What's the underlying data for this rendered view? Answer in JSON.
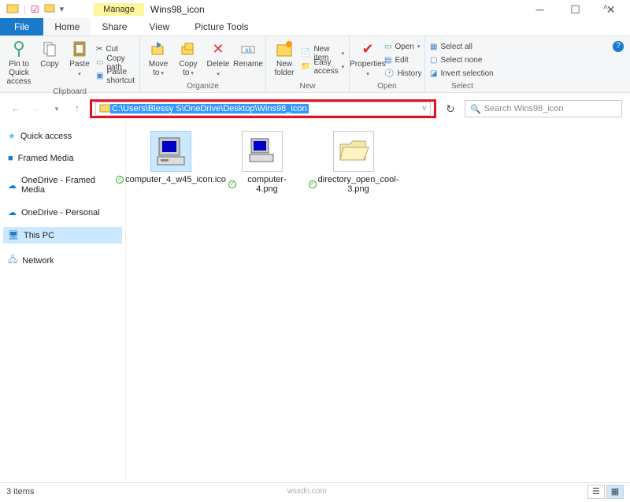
{
  "titlebar": {
    "manage": "Manage",
    "title": "Wins98_icon"
  },
  "file_tab": "File",
  "tabs": {
    "home": "Home",
    "share": "Share",
    "view": "View",
    "picture": "Picture Tools"
  },
  "ribbon": {
    "clipboard": {
      "pin": "Pin to Quick\naccess",
      "copy": "Copy",
      "paste": "Paste",
      "cut": "Cut",
      "copypath": "Copy path",
      "pasteshort": "Paste shortcut",
      "label": "Clipboard"
    },
    "organize": {
      "moveto": "Move\nto",
      "copyto": "Copy\nto",
      "delete": "Delete",
      "rename": "Rename",
      "label": "Organize"
    },
    "new": {
      "newfolder": "New\nfolder",
      "newitem": "New item",
      "easyaccess": "Easy access",
      "label": "New"
    },
    "open": {
      "properties": "Properties",
      "open": "Open",
      "edit": "Edit",
      "history": "History",
      "label": "Open"
    },
    "select": {
      "selectall": "Select all",
      "selectnone": "Select none",
      "invert": "Invert selection",
      "label": "Select"
    }
  },
  "address": {
    "path": "C:\\Users\\Blessy S\\OneDrive\\Desktop\\Wins98_icon",
    "search_placeholder": "Search Wins98_icon"
  },
  "sidebar": {
    "items": [
      {
        "label": "Quick access",
        "icon": "star",
        "color": "#4fc3f7"
      },
      {
        "label": "Framed Media",
        "icon": "square",
        "color": "#1979ca"
      },
      {
        "label": "OneDrive - Framed Media",
        "icon": "cloud",
        "color": "#1979ca"
      },
      {
        "label": "OneDrive - Personal",
        "icon": "cloud",
        "color": "#1979ca"
      },
      {
        "label": "This PC",
        "icon": "pc",
        "color": "#1979ca",
        "selected": true
      },
      {
        "label": "Network",
        "icon": "network",
        "color": "#5aa0d8"
      }
    ]
  },
  "files": {
    "items": [
      {
        "name": "computer_4_w45_icon.ico",
        "selected": true
      },
      {
        "name": "computer-4.png",
        "selected": false
      },
      {
        "name": "directory_open_cool-3.png",
        "selected": false
      }
    ]
  },
  "status": {
    "count": "3 items",
    "watermark": "wsxdn.com"
  }
}
